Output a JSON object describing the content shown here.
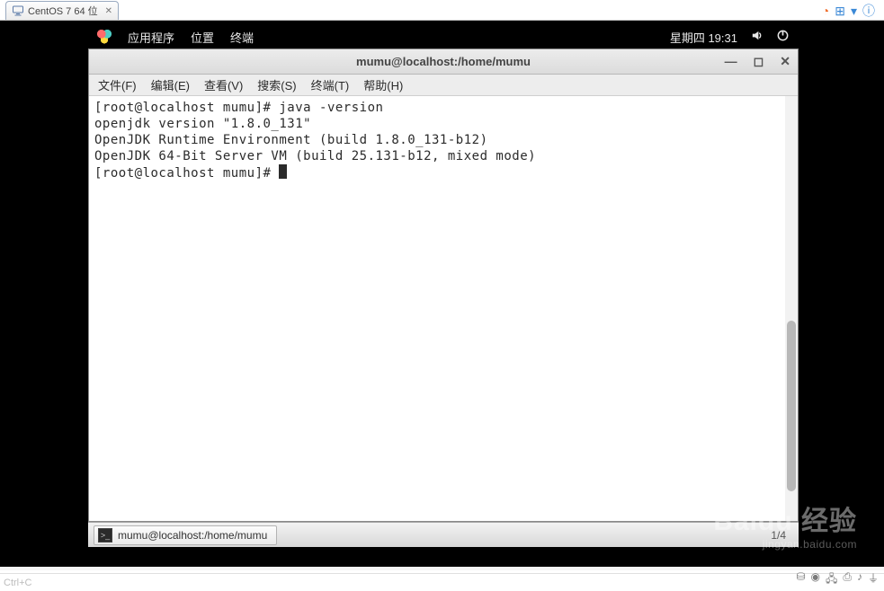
{
  "host_tab": {
    "label": "CentOS 7 64 位"
  },
  "gnome": {
    "menu_apps": "应用程序",
    "menu_places": "位置",
    "menu_terminal": "终端",
    "clock": "星期四 19:31"
  },
  "terminal": {
    "title": "mumu@localhost:/home/mumu",
    "menubar": {
      "file": "文件(F)",
      "edit": "编辑(E)",
      "view": "查看(V)",
      "search": "搜索(S)",
      "terminal": "终端(T)",
      "help": "帮助(H)"
    },
    "lines": {
      "l1_prompt": "[root@localhost mumu]# ",
      "l1_cmd": "java -version",
      "l2": "openjdk version \"1.8.0_131\"",
      "l3": "OpenJDK Runtime Environment (build 1.8.0_131-b12)",
      "l4": "OpenJDK 64-Bit Server VM (build 25.131-b12, mixed mode)",
      "l5_prompt": "[root@localhost mumu]# "
    }
  },
  "taskbar": {
    "button_label": "mumu@localhost:/home/mumu",
    "pager": "1/4"
  },
  "bottom_hint": "Ctrl+C",
  "watermark": {
    "brand": "Baidu 经验",
    "sub": "jingyan.baidu.com"
  }
}
